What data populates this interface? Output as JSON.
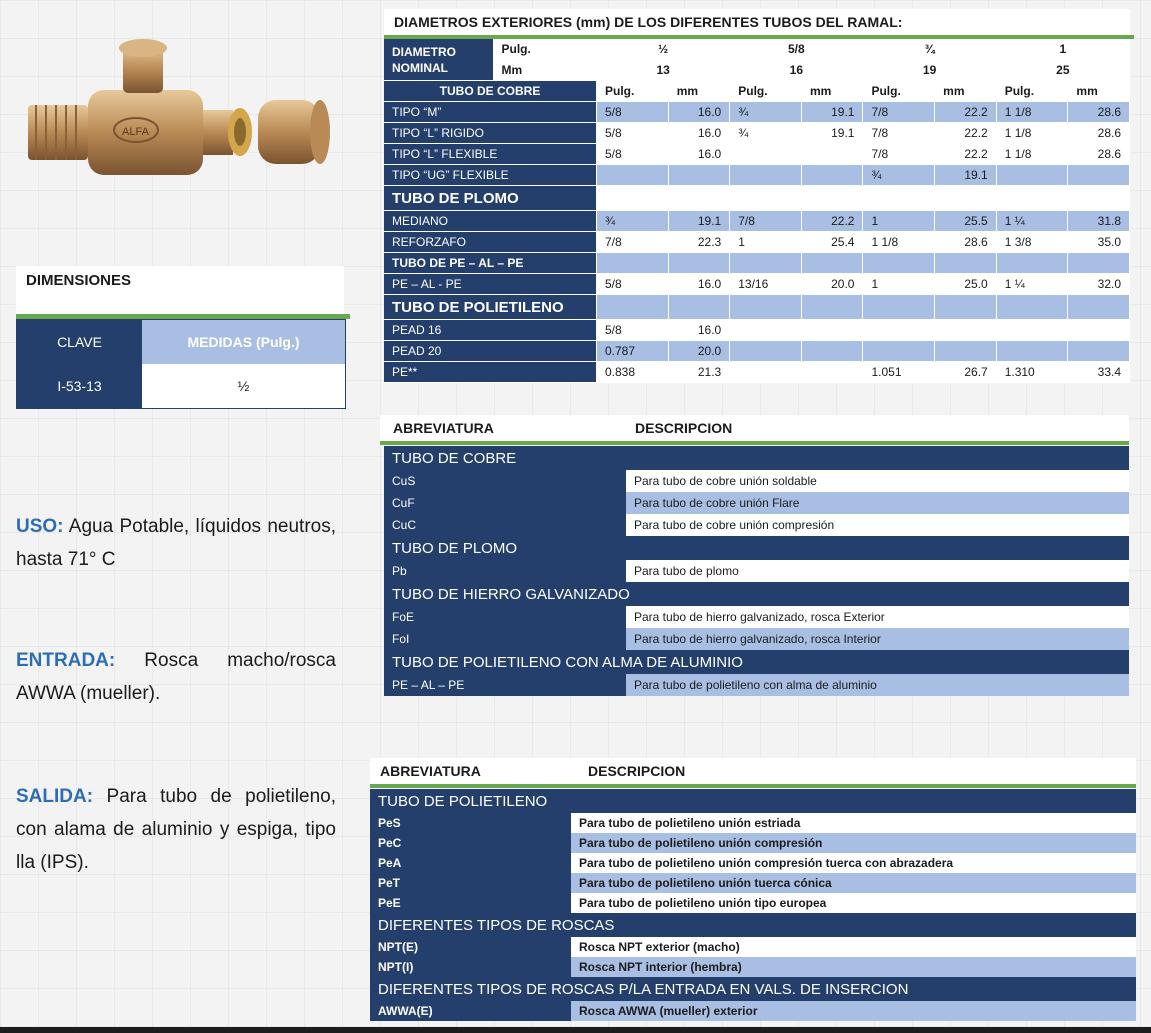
{
  "dimensiones": {
    "title": "DIMENSIONES",
    "col_clave": "CLAVE",
    "col_medidas": "MEDIDAS (Pulg.)",
    "row_clave": "I-53-13",
    "row_medida": "½"
  },
  "uso": {
    "label": "USO:",
    "text": "Agua Potable, líquidos neutros, hasta 71° C"
  },
  "entrada": {
    "label": "ENTRADA:",
    "text": "Rosca macho/rosca AWWA (mueller)."
  },
  "salida": {
    "label": "SALIDA:",
    "text": "Para tubo de polietileno, con alama de aluminio y espiga, tipo lla (IPS)."
  },
  "product": {
    "logo_text": "ALFA"
  },
  "diametros": {
    "title": "DIAMETROS EXTERIORES (mm) DE LOS DIFERENTES TUBOS DEL RAMAL:",
    "nominal_label": "DIAMETRO NOMINAL",
    "pulg_label": "Pulg.",
    "mm_label": "Mm",
    "nominal_pulg": [
      "½",
      "5/8",
      "¾",
      "1"
    ],
    "nominal_mm": [
      "13",
      "16",
      "19",
      "25"
    ],
    "cobre_title": "TUBO DE COBRE",
    "sub_headers": [
      "Pulg.",
      "mm",
      "Pulg.",
      "mm",
      "Pulg.",
      "mm",
      "Pulg.",
      "mm"
    ],
    "rows": [
      {
        "label": "TIPO “M”",
        "cells": [
          "5/8",
          "16.0",
          "¾",
          "19.1",
          "7/8",
          "22.2",
          "1 1/8",
          "28.6"
        ],
        "shade": "lblue"
      },
      {
        "label": "TIPO “L” RIGIDO",
        "cells": [
          "5/8",
          "16.0",
          "¾",
          "19.1",
          "7/8",
          "22.2",
          "1 1/8",
          "28.6"
        ],
        "shade": "white"
      },
      {
        "label": "TIPO “L” FLEXIBLE",
        "cells": [
          "5/8",
          "16.0",
          "",
          "",
          "7/8",
          "22.2",
          "1 1/8",
          "28.6"
        ],
        "shade": "white"
      },
      {
        "label": "TIPO “UG” FLEXIBLE",
        "cells": [
          "",
          "",
          "",
          "",
          "¾",
          "19.1",
          "",
          ""
        ],
        "shade": "lblue"
      },
      {
        "label": "TUBO DE PLOMO",
        "big": true,
        "cells": [
          "",
          "",
          "",
          "",
          "",
          "",
          "",
          ""
        ],
        "shade": "white"
      },
      {
        "label": "MEDIANO",
        "cells": [
          "¾",
          "19.1",
          "7/8",
          "22.2",
          "1",
          "25.5",
          "1 ¼",
          "31.8"
        ],
        "shade": "lblue"
      },
      {
        "label": "REFORZAFO",
        "cells": [
          "7/8",
          "22.3",
          "1",
          "25.4",
          "1 1/8",
          "28.6",
          "1 3/8",
          "35.0"
        ],
        "shade": "white"
      },
      {
        "label": "TUBO DE PE – AL – PE",
        "bold": true,
        "cells": [
          "",
          "",
          "",
          "",
          "",
          "",
          "",
          ""
        ],
        "shade": "lblue"
      },
      {
        "label": "PE – AL - PE",
        "cells": [
          "5/8",
          "16.0",
          "13/16",
          "20.0",
          "1",
          "25.0",
          "1 ¼",
          "32.0"
        ],
        "shade": "white"
      },
      {
        "label": "TUBO DE POLIETILENO",
        "big": true,
        "cells": [
          "",
          "",
          "",
          "",
          "",
          "",
          "",
          ""
        ],
        "shade": "lblue"
      },
      {
        "label": "PEAD 16",
        "cells": [
          "5/8",
          "16.0",
          "",
          "",
          "",
          "",
          "",
          ""
        ],
        "shade": "white"
      },
      {
        "label": "PEAD 20",
        "cells": [
          "0.787",
          "20.0",
          "",
          "",
          "",
          "",
          "",
          ""
        ],
        "shade": "lblue"
      },
      {
        "label": "PE**",
        "cells": [
          "0.838",
          "21.3",
          "",
          "",
          "1.051",
          "26.7",
          "1.310",
          "33.4"
        ],
        "shade": "white"
      }
    ]
  },
  "abrev1": {
    "col_abbr": "ABREVIATURA",
    "col_desc": "DESCRIPCION",
    "sections": [
      {
        "title": "TUBO DE COBRE",
        "rows": [
          {
            "abbr": "CuS",
            "desc": "Para tubo de cobre unión soldable",
            "shade": "white"
          },
          {
            "abbr": "CuF",
            "desc": "Para tubo de cobre unión Flare",
            "shade": "lblue"
          },
          {
            "abbr": "CuC",
            "desc": "Para tubo de cobre unión compresión",
            "shade": "white"
          }
        ]
      },
      {
        "title": "TUBO DE PLOMO",
        "rows": [
          {
            "abbr": "Pb",
            "desc": "Para tubo de plomo",
            "shade": "white"
          }
        ]
      },
      {
        "title": "TUBO DE HIERRO GALVANIZADO",
        "rows": [
          {
            "abbr": "FoE",
            "desc": "Para tubo de hierro galvanizado, rosca Exterior",
            "shade": "white"
          },
          {
            "abbr": "FoI",
            "desc": "Para tubo de hierro galvanizado, rosca Interior",
            "shade": "lblue"
          }
        ]
      },
      {
        "title": "TUBO DE POLIETILENO CON ALMA DE ALUMINIO",
        "small": true,
        "rows": [
          {
            "abbr": "PE – AL – PE",
            "desc": "Para tubo de polietileno con alma de aluminio",
            "shade": "lblue"
          }
        ]
      }
    ]
  },
  "abrev2": {
    "col_abbr": "ABREVIATURA",
    "col_desc": "DESCRIPCION",
    "sections": [
      {
        "title": "TUBO DE POLIETILENO",
        "rows": [
          {
            "abbr": "PeS",
            "desc": "Para tubo de polietileno unión estriada",
            "shade": "white"
          },
          {
            "abbr": "PeC",
            "desc": "Para tubo de polietileno unión compresión",
            "shade": "lblue"
          },
          {
            "abbr": "PeA",
            "desc": "Para tubo de polietileno unión compresión tuerca con abrazadera",
            "shade": "white"
          },
          {
            "abbr": "PeT",
            "desc": "Para tubo de polietileno unión tuerca cónica",
            "shade": "lblue"
          },
          {
            "abbr": "PeE",
            "desc": "Para tubo de polietileno unión tipo europea",
            "shade": "white"
          }
        ]
      },
      {
        "title": "DIFERENTES TIPOS DE ROSCAS",
        "rows": [
          {
            "abbr": "NPT(E)",
            "desc": "Rosca NPT exterior (macho)",
            "shade": "white"
          },
          {
            "abbr": "NPT(I)",
            "desc": "Rosca NPT interior (hembra)",
            "shade": "lblue"
          }
        ]
      },
      {
        "title": "DIFERENTES TIPOS DE ROSCAS P/LA ENTRADA EN VALS. DE INSERCION",
        "rows": [
          {
            "abbr": "AWWA(E)",
            "desc": "Rosca AWWA (mueller) exterior",
            "shade": "lblue"
          }
        ]
      }
    ]
  }
}
